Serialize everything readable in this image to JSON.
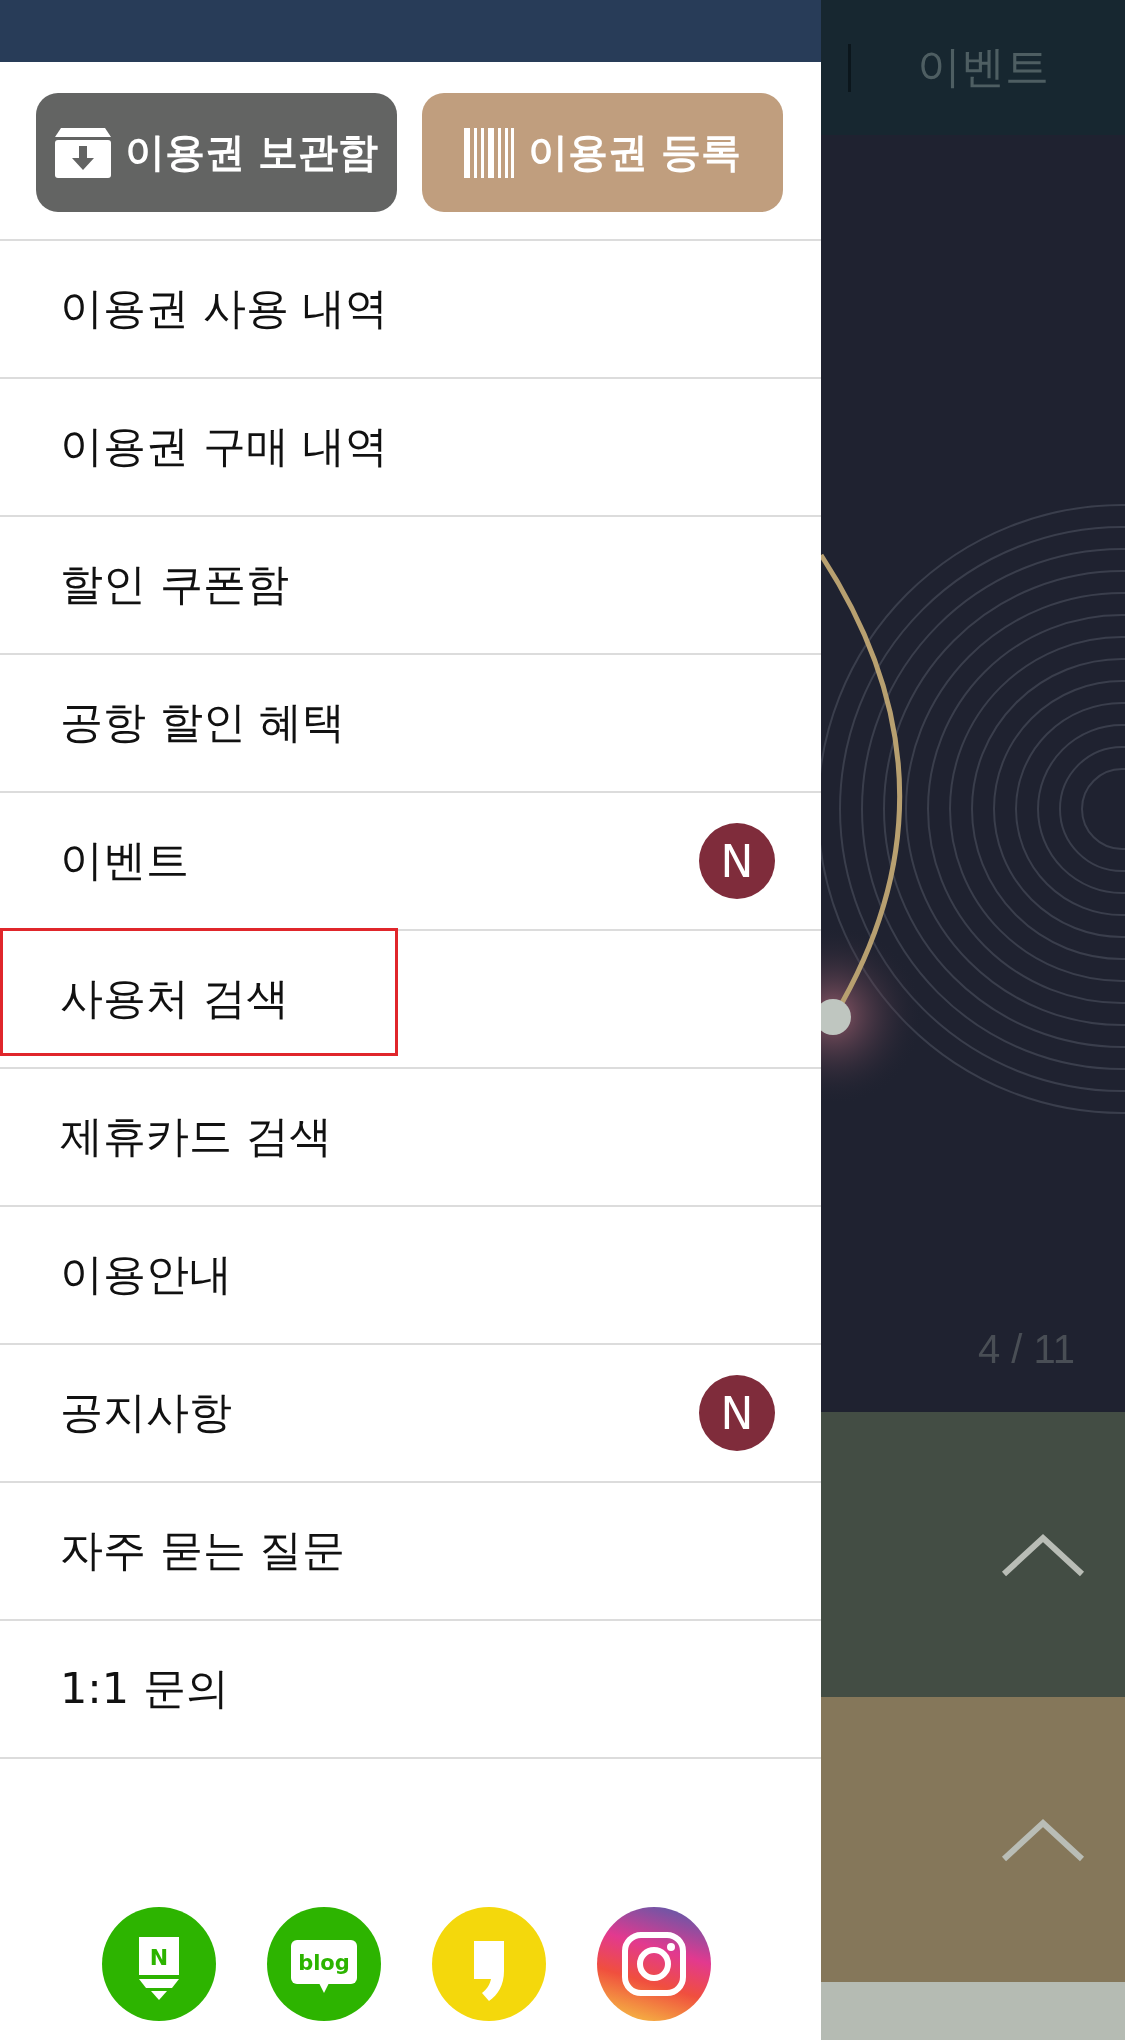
{
  "drawer": {
    "buttons": [
      {
        "kind": "storage",
        "label": "이용권 보관함"
      },
      {
        "kind": "register",
        "label": "이용권 등록"
      }
    ],
    "menu": [
      {
        "label": "이용권 사용 내역",
        "highlighted": false
      },
      {
        "label": "이용권 구매 내역",
        "highlighted": false
      },
      {
        "label": "할인 쿠폰함",
        "highlighted": false
      },
      {
        "label": "공항 할인 혜택",
        "highlighted": false
      },
      {
        "label": "이벤트",
        "badge": "N",
        "highlighted": false
      },
      {
        "label": "사용처 검색",
        "highlighted": true
      },
      {
        "label": "제휴카드 검색",
        "highlighted": false
      },
      {
        "label": "이용안내",
        "highlighted": false
      },
      {
        "label": "공지사항",
        "badge": "N",
        "highlighted": false
      },
      {
        "label": "자주 묻는 질문",
        "highlighted": false
      },
      {
        "label": "1:1 문의",
        "highlighted": false
      }
    ],
    "social": [
      {
        "kind": "post",
        "label": "N"
      },
      {
        "kind": "blog",
        "label": "blog"
      },
      {
        "kind": "story"
      },
      {
        "kind": "instagram"
      }
    ]
  },
  "background": {
    "tab": "이벤트",
    "slide_counter": "4 / 11"
  }
}
